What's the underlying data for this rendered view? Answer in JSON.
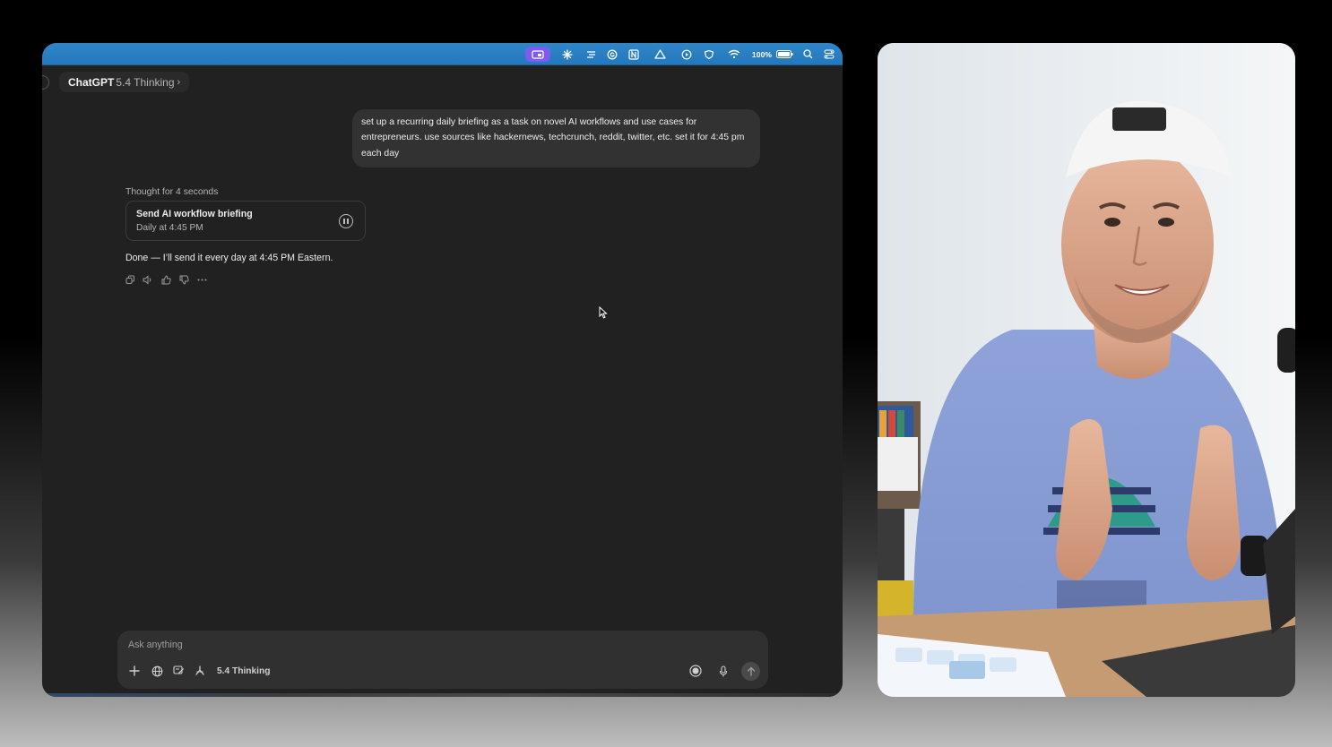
{
  "menubar": {
    "battery_percent": "100%",
    "icons": [
      "screen-share-icon",
      "asterisk-icon",
      "list-icon",
      "grammarly-icon",
      "notion-icon",
      "drive-icon",
      "play-icon",
      "shield-icon",
      "wifi-icon",
      "battery-icon",
      "search-icon",
      "control-center-icon"
    ]
  },
  "header": {
    "brand": "ChatGPT",
    "model": "5.4 Thinking",
    "chevron": "›"
  },
  "conversation": {
    "user_message": "set up a recurring daily briefing as a task on novel AI workflows and use cases for entrepreneurs. use sources like hackernews, techcrunch, reddit, twitter, etc. set it for 4:45 pm each day",
    "thought_label": "Thought for 4 seconds",
    "task": {
      "title": "Send AI workflow briefing",
      "schedule": "Daily at 4:45 PM"
    },
    "assistant_reply": "Done — I’ll send it every day at 4:45 PM Eastern.",
    "action_icons": [
      "copy-icon",
      "read-aloud-icon",
      "thumbs-up-icon",
      "thumbs-down-icon",
      "more-icon"
    ]
  },
  "composer": {
    "placeholder": "Ask anything",
    "model_label": "5.4 Thinking",
    "tools": [
      "plus-icon",
      "globe-icon",
      "canvas-icon",
      "tools-icon"
    ],
    "right_icons": [
      "voice-mode-icon",
      "microphone-icon",
      "send-arrow-icon"
    ]
  },
  "colors": {
    "menubar": "#2f86c9",
    "active_menu_item": "#7c5cf0",
    "app_background": "#212121",
    "bubble": "#323232"
  }
}
